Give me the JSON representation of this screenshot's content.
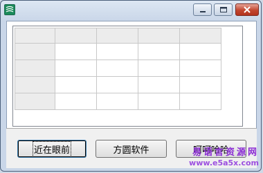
{
  "window": {
    "controls": {
      "minimize_icon": "minimize-icon",
      "maximize_icon": "maximize-icon",
      "close_icon": "close-icon"
    }
  },
  "grid": {
    "rows": 5,
    "columns": 5,
    "fixed_row": true,
    "fixed_column": true,
    "cells": [
      [
        "",
        "",
        "",
        "",
        ""
      ],
      [
        "",
        "",
        "",
        "",
        ""
      ],
      [
        "",
        "",
        "",
        "",
        ""
      ],
      [
        "",
        "",
        "",
        "",
        ""
      ],
      [
        "",
        "",
        "",
        "",
        ""
      ]
    ]
  },
  "buttons": {
    "button1_label": "近在眼前",
    "button2_label": "方圆软件",
    "button3_label": "呵呵哈哈"
  },
  "watermark": {
    "chinese": "易语言资源网",
    "url": "www.e5a5x.com"
  },
  "colors": {
    "titlebar": "#d3ddeb",
    "close_button": "#c2462f",
    "grid_lines": "#c8c8c8",
    "fixed_cells": "#ececec",
    "watermark": "#8a2bd4"
  }
}
